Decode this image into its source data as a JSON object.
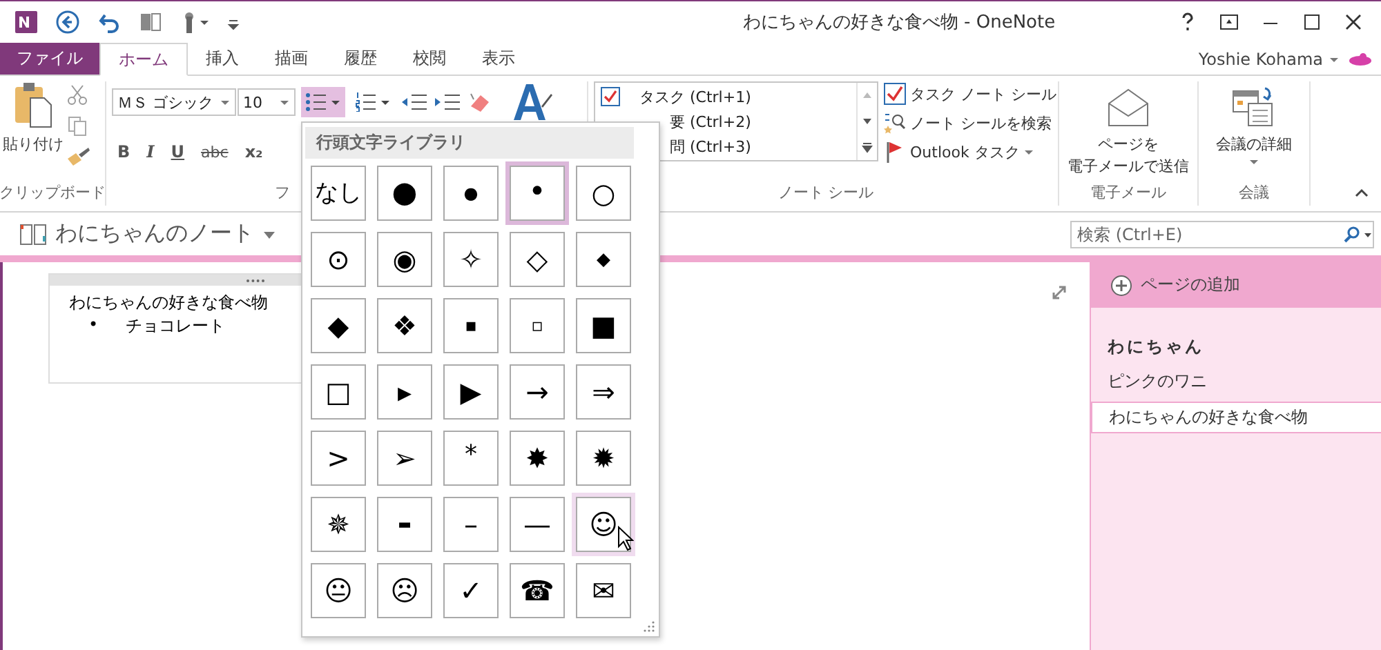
{
  "window": {
    "title": "わにちゃんの好きな食べ物 - OneNote",
    "user": "Yoshie Kohama"
  },
  "tabs": [
    {
      "label": "ファイル",
      "kind": "file",
      "selected": false
    },
    {
      "label": "ホーム",
      "kind": "tab",
      "selected": true
    },
    {
      "label": "挿入",
      "kind": "tab",
      "selected": false
    },
    {
      "label": "描画",
      "kind": "tab",
      "selected": false
    },
    {
      "label": "履歴",
      "kind": "tab",
      "selected": false
    },
    {
      "label": "校閲",
      "kind": "tab",
      "selected": false
    },
    {
      "label": "表示",
      "kind": "tab",
      "selected": false
    }
  ],
  "ribbon": {
    "clipboard": {
      "paste": "貼り付け",
      "label": "クリップボード"
    },
    "font": {
      "font_name": "ＭＳ ゴシック",
      "font_size": "10",
      "format_buttons": [
        "B",
        "I",
        "U",
        "abc",
        "x₂"
      ],
      "label": "フ"
    },
    "tags": {
      "items": [
        {
          "label": "タスク (Ctrl+1)",
          "kind": "task"
        },
        {
          "label": "要 (Ctrl+2)",
          "kind": "other"
        },
        {
          "label": "問 (Ctrl+3)",
          "kind": "other"
        }
      ],
      "task_tag": "タスク ノート シール",
      "find_tags": "ノート シールを検索",
      "outlook_task": "Outlook タスク",
      "label": "ノート シール"
    },
    "email": {
      "button": [
        "ページを",
        "電子メールで送信"
      ],
      "label": "電子メール"
    },
    "meeting": {
      "button": "会議の詳細",
      "label": "会議"
    }
  },
  "bullet_library": {
    "title": "行頭文字ライブラリ",
    "bullets": [
      {
        "symbol": "なし",
        "selected": false,
        "hovered": false
      },
      {
        "symbol": "⬤",
        "selected": false,
        "hovered": false
      },
      {
        "symbol": "●",
        "selected": false,
        "hovered": false
      },
      {
        "symbol": "•",
        "selected": true,
        "hovered": false
      },
      {
        "symbol": "○",
        "selected": false,
        "hovered": false
      },
      {
        "symbol": "⊙",
        "selected": false,
        "hovered": false
      },
      {
        "symbol": "◉",
        "selected": false,
        "hovered": false
      },
      {
        "symbol": "✧",
        "selected": false,
        "hovered": false
      },
      {
        "symbol": "◇",
        "selected": false,
        "hovered": false
      },
      {
        "symbol": "◆",
        "selected": false,
        "hovered": false
      },
      {
        "symbol": "◆",
        "selected": false,
        "hovered": false
      },
      {
        "symbol": "❖",
        "selected": false,
        "hovered": false
      },
      {
        "symbol": "▪",
        "selected": false,
        "hovered": false
      },
      {
        "symbol": "▫",
        "selected": false,
        "hovered": false
      },
      {
        "symbol": "■",
        "selected": false,
        "hovered": false
      },
      {
        "symbol": "□",
        "selected": false,
        "hovered": false
      },
      {
        "symbol": "▸",
        "selected": false,
        "hovered": false
      },
      {
        "symbol": "▶",
        "selected": false,
        "hovered": false
      },
      {
        "symbol": "→",
        "selected": false,
        "hovered": false
      },
      {
        "symbol": "⇒",
        "selected": false,
        "hovered": false
      },
      {
        "symbol": ">",
        "selected": false,
        "hovered": false
      },
      {
        "symbol": "➢",
        "selected": false,
        "hovered": false
      },
      {
        "symbol": "*",
        "selected": false,
        "hovered": false
      },
      {
        "symbol": "✸",
        "selected": false,
        "hovered": false
      },
      {
        "symbol": "✹",
        "selected": false,
        "hovered": false
      },
      {
        "symbol": "✵",
        "selected": false,
        "hovered": false
      },
      {
        "symbol": "-",
        "selected": false,
        "hovered": false
      },
      {
        "symbol": "–",
        "selected": false,
        "hovered": false
      },
      {
        "symbol": "—",
        "selected": false,
        "hovered": false
      },
      {
        "symbol": "☺",
        "selected": false,
        "hovered": true
      },
      {
        "symbol": "😐",
        "selected": false,
        "hovered": false
      },
      {
        "symbol": "☹",
        "selected": false,
        "hovered": false
      },
      {
        "symbol": "✓",
        "selected": false,
        "hovered": false
      },
      {
        "symbol": "☎",
        "selected": false,
        "hovered": false
      },
      {
        "symbol": "✉",
        "selected": false,
        "hovered": false
      }
    ]
  },
  "notebook": {
    "name": "わにちゃんのノート"
  },
  "search": {
    "placeholder": "検索 (Ctrl+E)"
  },
  "note": {
    "title": "わにちゃんの好きな食べ物",
    "items": [
      {
        "bullet": "•",
        "text": "チョコレート"
      }
    ]
  },
  "pages": {
    "add": "ページの追加",
    "items": [
      {
        "title": "わにちゃん",
        "selected": false
      },
      {
        "title": "ピンクのワニ",
        "selected": false
      },
      {
        "title": "わにちゃんの好きな食べ物",
        "selected": true
      }
    ]
  }
}
